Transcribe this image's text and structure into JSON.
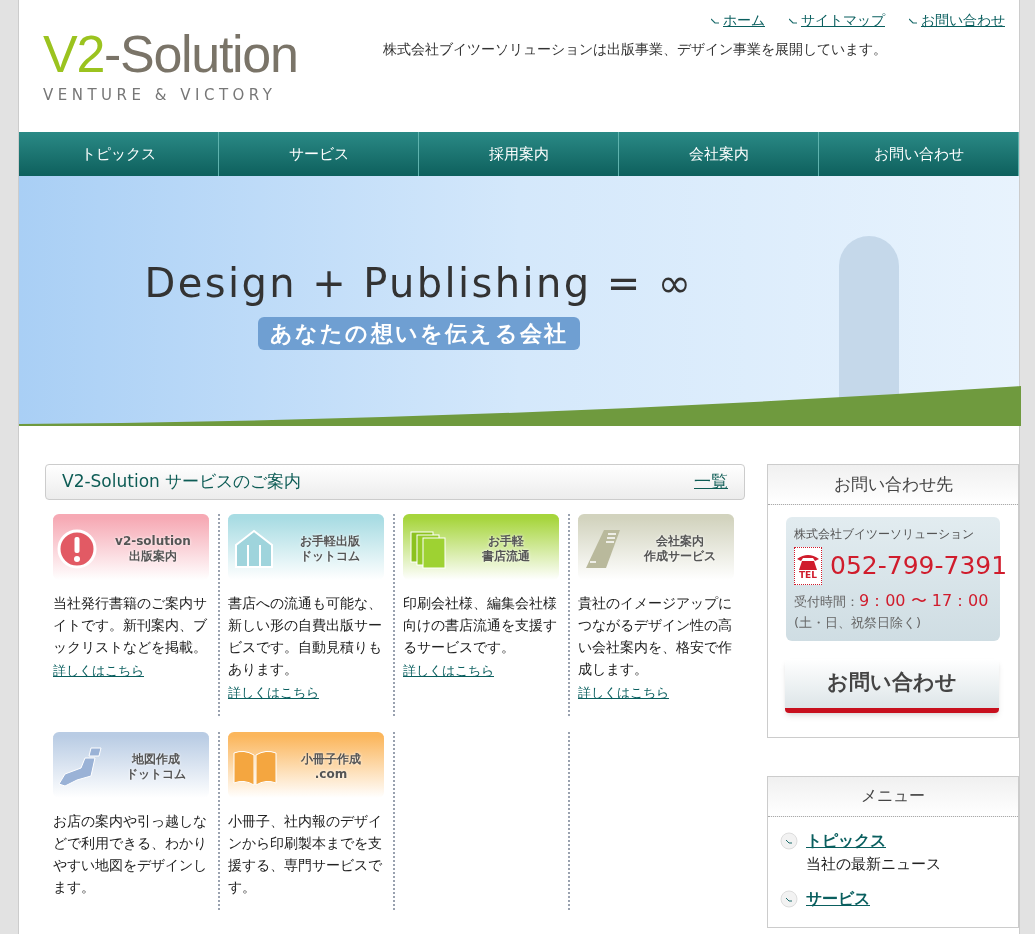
{
  "header": {
    "logo": {
      "name_part1": "V2",
      "name_part2": "-Solution",
      "tagline": "VENTURE & VICTORY"
    },
    "top_links": [
      "ホーム",
      "サイトマップ",
      "お問い合わせ"
    ],
    "description": "株式会社ブイツーソリューションは出版事業、デザイン事業を展開しています。"
  },
  "nav": {
    "items": [
      "トピックス",
      "サービス",
      "採用案内",
      "会社案内",
      "お問い合わせ"
    ]
  },
  "hero": {
    "title": "Design + Publishing = ∞",
    "subtitle": "あなたの想いを伝える会社"
  },
  "services": {
    "heading": "V2-Solution サービスのご案内",
    "more_link": "一覧",
    "cards": [
      {
        "kind": "alert",
        "color": "#f6a9b4",
        "banner_title": "v2-solution",
        "banner_subtitle": "出版案内",
        "text": "当社発行書籍のご案内サイトです。新刊案内、ブックリストなどを掲載。",
        "link": "詳しくはこちら"
      },
      {
        "kind": "house",
        "color": "#a8dce3",
        "banner_title": "お手軽出版",
        "banner_subtitle": "ドットコム",
        "text": "書店への流通も可能な、新しい形の自費出版サービスです。自動見積りもあります。",
        "link": "詳しくはこちら"
      },
      {
        "kind": "books",
        "color": "#a6d53c",
        "banner_title": "お手軽",
        "banner_subtitle": "書店流通",
        "text": "印刷会社様、編集会社様向けの書店流通を支援するサービスです。",
        "link": "詳しくはこちら"
      },
      {
        "kind": "building",
        "color": "#d2d3be",
        "banner_title": "会社案内",
        "banner_subtitle": "作成サービス",
        "text": "貴社のイメージアップにつながるデザイン性の高い会社案内を、格安で作成します。",
        "link": "詳しくはこちら"
      },
      {
        "kind": "map",
        "color": "#b9cce4",
        "banner_title": "地図作成",
        "banner_subtitle": "ドットコム",
        "text": "お店の案内や引っ越しなどで利用できる、わかりやすい地図をデザインします。"
      },
      {
        "kind": "book",
        "color": "#fbb65c",
        "banner_title": "小冊子作成",
        "banner_subtitle": ".com",
        "text": "小冊子、社内報のデザインから印刷製本までを支援する、専門サービスです。"
      }
    ]
  },
  "contact": {
    "heading": "お問い合わせ先",
    "company": "株式会社ブイツーソリューション",
    "tel_label": "TEL",
    "phone": "052-799-7391",
    "hours_label": "受付時間：",
    "hours": "9：00 〜 17：00",
    "closed": "(土・日、祝祭日除く)",
    "button": "お問い合わせ"
  },
  "menu": {
    "heading": "メニュー",
    "items": [
      {
        "label": "トピックス",
        "description": "当社の最新ニュース"
      },
      {
        "label": "サービス"
      }
    ]
  }
}
